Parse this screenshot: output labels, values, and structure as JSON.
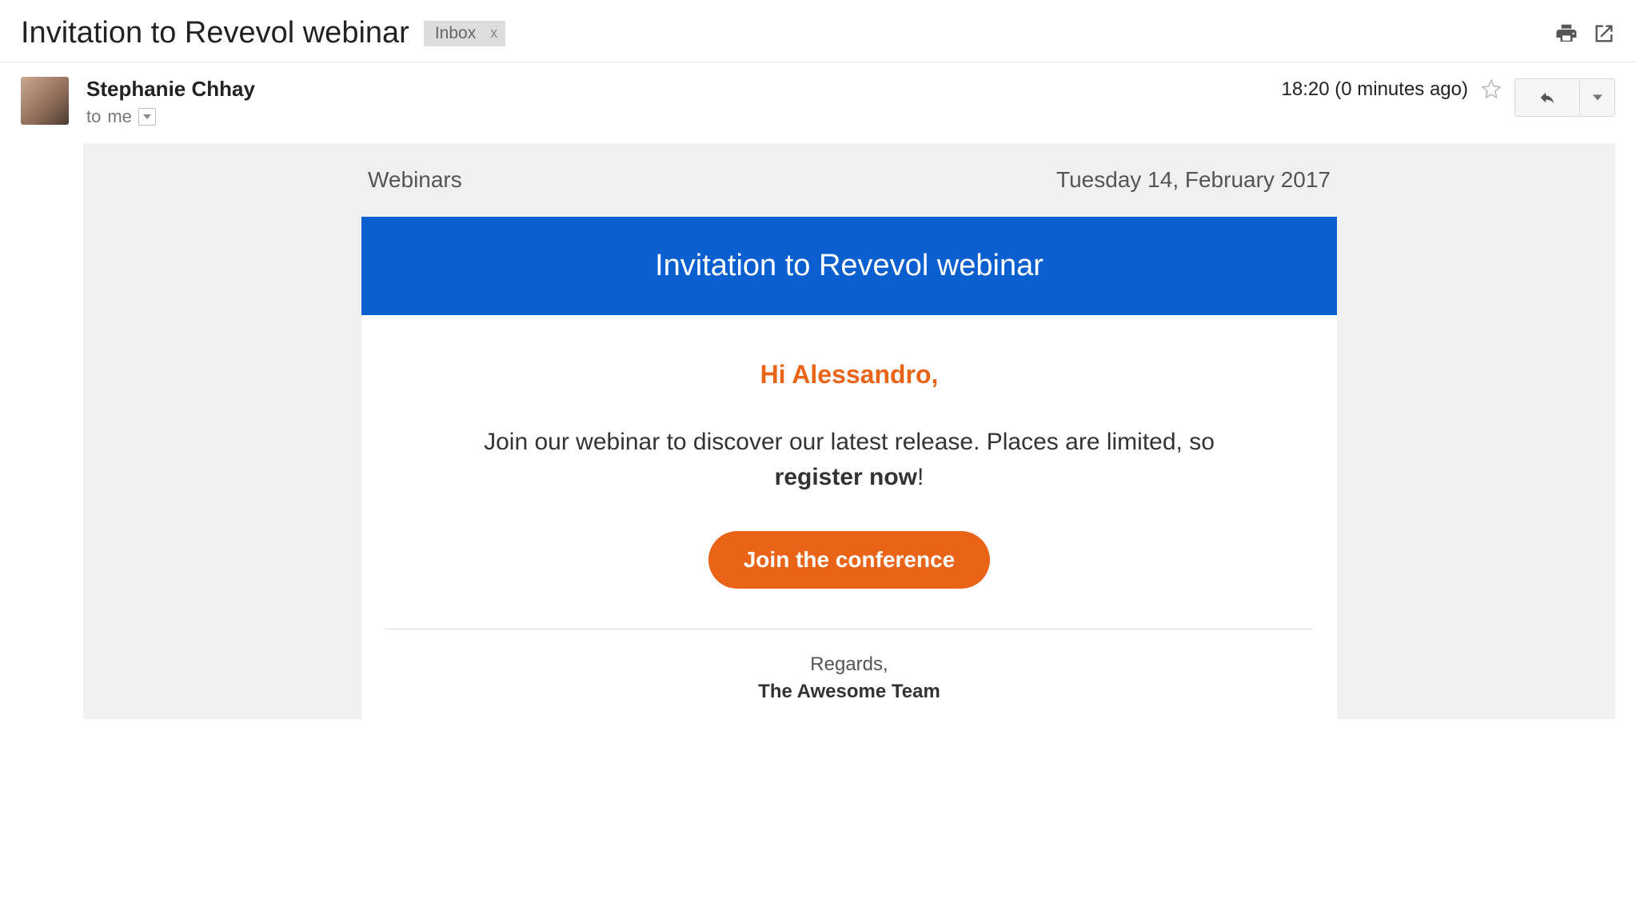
{
  "header": {
    "subject": "Invitation to Revevol webinar",
    "inbox_label": "Inbox"
  },
  "meta": {
    "sender": "Stephanie Chhay",
    "to_prefix": "to",
    "to_recipient": "me",
    "time": "18:20 (0 minutes ago)"
  },
  "email": {
    "category": "Webinars",
    "date": "Tuesday 14, February 2017",
    "banner_title": "Invitation to Revevol webinar",
    "greeting": "Hi Alessandro,",
    "body_lead": "Join our webinar to discover our latest release. Places are limited, so ",
    "body_bold": "register now",
    "body_tail": "!",
    "cta": "Join the conference",
    "regards": "Regards,",
    "team": "The Awesome Team"
  }
}
